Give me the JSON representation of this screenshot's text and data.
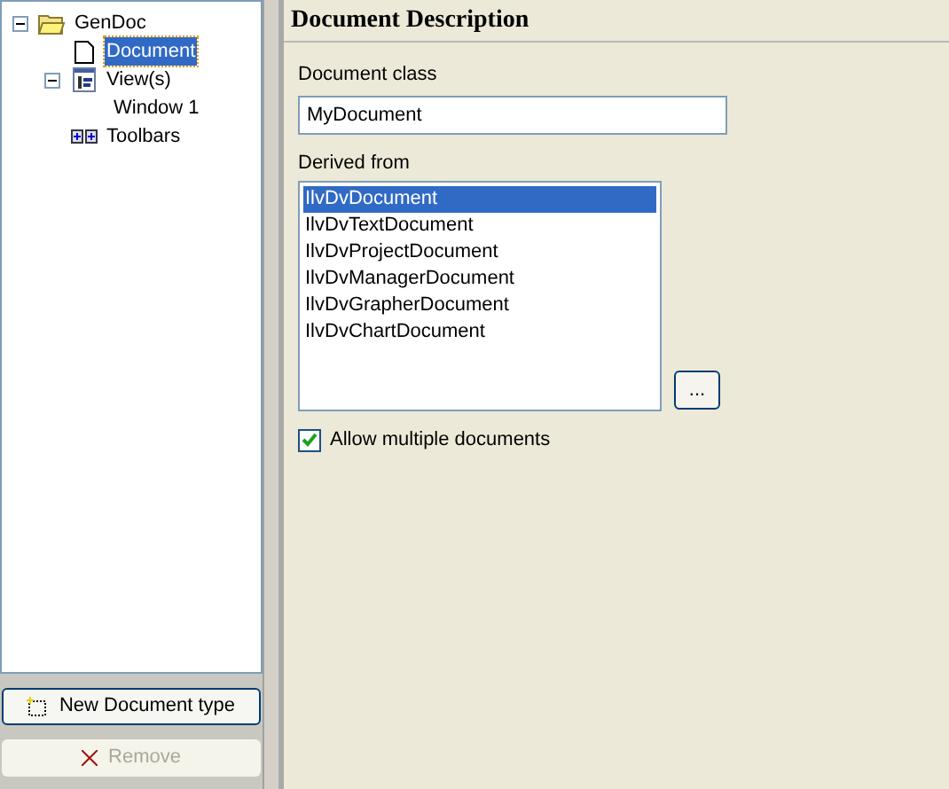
{
  "tree": [
    {
      "label": "GenDoc",
      "kind": "folder",
      "expanded": true,
      "selected": false,
      "children": [
        {
          "label": "Document",
          "kind": "page",
          "selected": true
        },
        {
          "label": "View(s)",
          "kind": "view",
          "expanded": true,
          "selected": false,
          "children": [
            {
              "label": "Window 1",
              "selected": false
            }
          ]
        },
        {
          "label": "Toolbars",
          "kind": "toolbar",
          "selected": false
        }
      ]
    }
  ],
  "buttons": [
    {
      "label": "New Document type",
      "kind": "new",
      "disabled": false
    },
    {
      "label": "Remove",
      "kind": "remove",
      "disabled": true
    }
  ],
  "panel": {
    "title": "Document Description",
    "class_label": "Document class",
    "class_value": "MyDocument",
    "derived_label": "Derived from",
    "derived_items": [
      {
        "label": "IlvDvDocument",
        "selected": true
      },
      {
        "label": "IlvDvTextDocument",
        "selected": false
      },
      {
        "label": "IlvDvProjectDocument",
        "selected": false
      },
      {
        "label": "IlvDvManagerDocument",
        "selected": false
      },
      {
        "label": "IlvDvGrapherDocument",
        "selected": false
      },
      {
        "label": "IlvDvChartDocument",
        "selected": false
      }
    ],
    "browse_button": "...",
    "checkbox": {
      "label": "Allow multiple documents",
      "checked": true
    }
  }
}
